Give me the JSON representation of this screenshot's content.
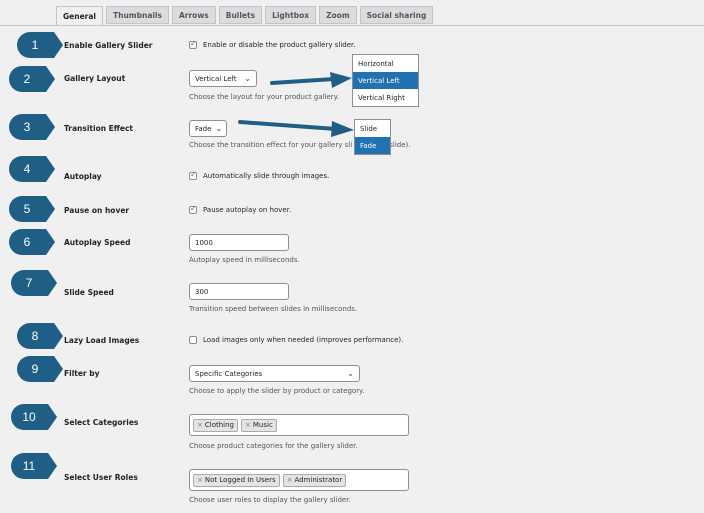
{
  "tabs": [
    "General",
    "Thumbnails",
    "Arrows",
    "Bullets",
    "Lightbox",
    "Zoom",
    "Social sharing"
  ],
  "badges": [
    "1",
    "2",
    "3",
    "4",
    "5",
    "6",
    "7",
    "8",
    "9",
    "10",
    "11"
  ],
  "colors": {
    "badge": "#1f5f86",
    "accent": "#2271b1",
    "arrow": "#1f5f86"
  },
  "fields": {
    "enable_slider": {
      "label": "Enable Gallery Slider",
      "checkbox_text": "Enable or disable the product gallery slider.",
      "checked": true
    },
    "gallery_layout": {
      "label": "Gallery Layout",
      "value": "Vertical Left",
      "desc": "Choose the layout for your product gallery.",
      "options": [
        "Horizontal",
        "Vertical Left",
        "Vertical Right"
      ]
    },
    "transition": {
      "label": "Transition Effect",
      "value": "Fade",
      "desc_pre": "Choose the transition effect for your gallery sli",
      "desc_post": "r slide).",
      "options": [
        "Slide",
        "Fade"
      ]
    },
    "autoplay": {
      "label": "Autoplay",
      "checkbox_text": "Automatically slide through images.",
      "checked": true
    },
    "pause_hover": {
      "label": "Pause on hover",
      "checkbox_text": "Pause autoplay on hover.",
      "checked": true
    },
    "autoplay_speed": {
      "label": "Autoplay Speed",
      "value": "1000",
      "desc": "Autoplay speed in milliseconds."
    },
    "slide_speed": {
      "label": "Slide Speed",
      "value": "300",
      "desc": "Transition speed between slides in milliseconds."
    },
    "lazy_load": {
      "label": "Lazy Load Images",
      "checkbox_text": "Load images only when needed (improves performance).",
      "checked": false
    },
    "filter_by": {
      "label": "Filter by",
      "value": "Specific Categories",
      "desc": "Choose to apply the slider by product or category."
    },
    "select_categories": {
      "label": "Select Categories",
      "tags": [
        "Clothing",
        "Music"
      ],
      "desc": "Choose product categories for the gallery slider."
    },
    "select_roles": {
      "label": "Select User Roles",
      "tags": [
        "Not Logged In Users",
        "Administrator"
      ],
      "desc": "Choose user roles to display the gallery slider."
    }
  },
  "icons": {
    "remove_tag": "×",
    "chevron": "⌄",
    "check": "✓"
  }
}
